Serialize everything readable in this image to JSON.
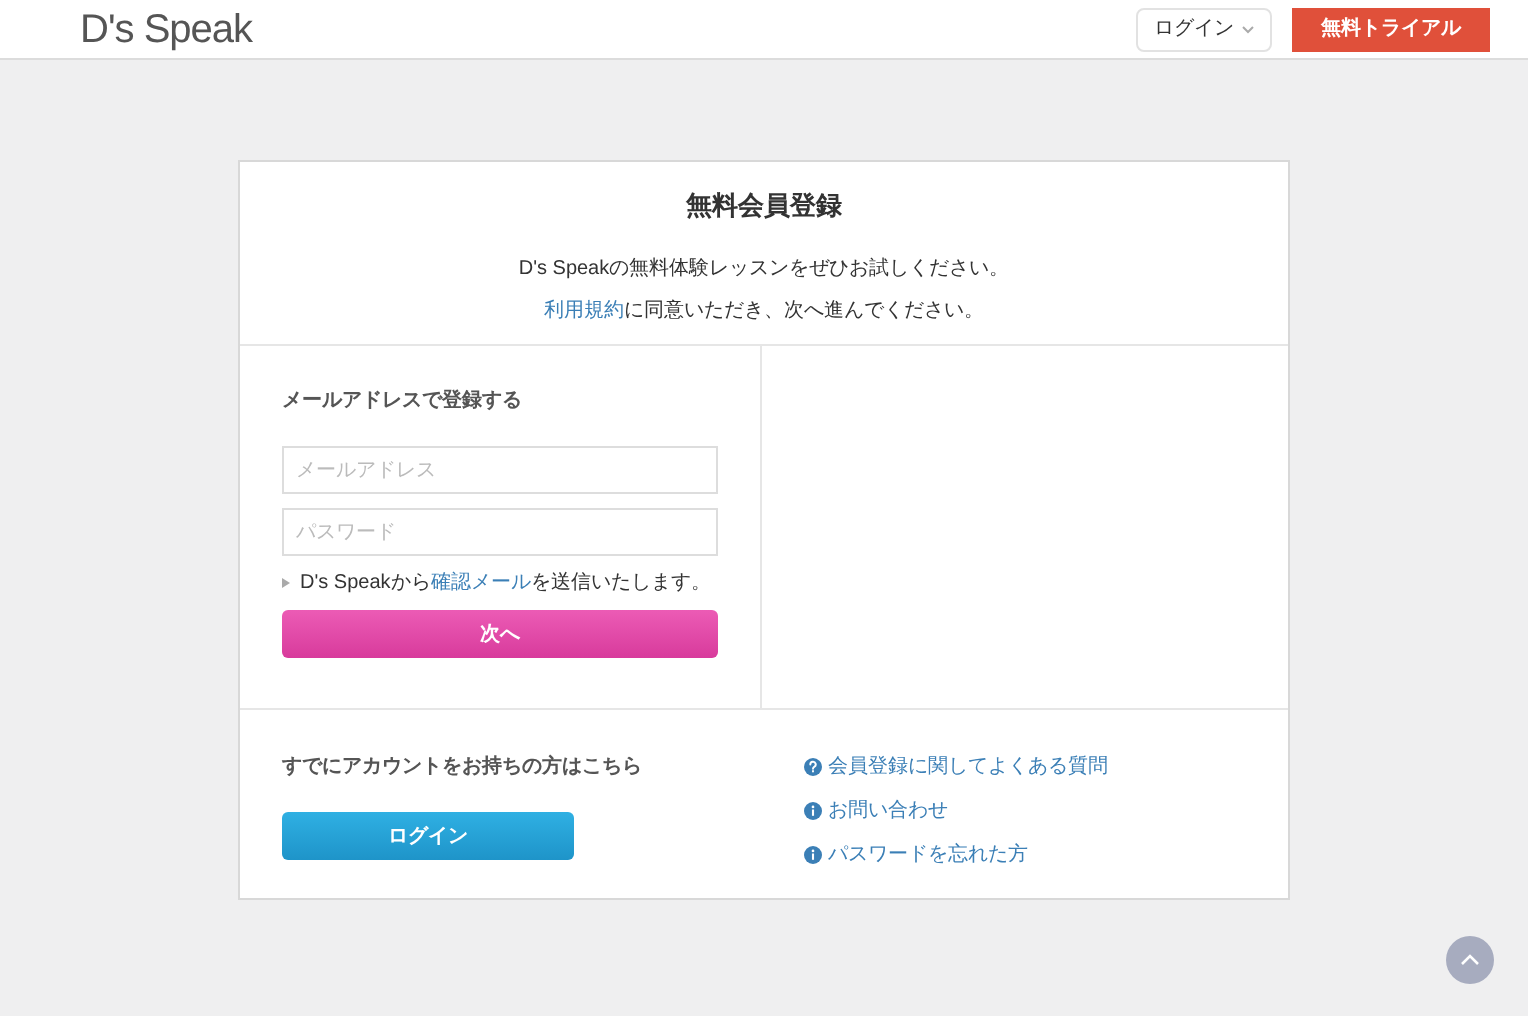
{
  "header": {
    "logo": "D's Speak",
    "login_menu": "ログイン",
    "trial_button": "無料トライアル"
  },
  "card": {
    "title": "無料会員登録",
    "intro": "D's Speakの無料体験レッスンをぜひお試しください。",
    "terms": {
      "link": "利用規約",
      "after": "に同意いただき、次へ進んでください。"
    },
    "email_section": {
      "heading": "メールアドレスで登録する",
      "email_placeholder": "メールアドレス",
      "password_placeholder": "パスワード",
      "notice": {
        "before": "D's Speakから",
        "link": "確認メール",
        "after": "を送信いたします。"
      },
      "next_button": "次へ"
    },
    "account": {
      "heading": "すでにアカウントをお持ちの方はこちら",
      "login_button": "ログイン"
    },
    "links": [
      {
        "kind": "question",
        "label": "会員登録に関してよくある質問"
      },
      {
        "kind": "info",
        "label": "お問い合わせ"
      },
      {
        "kind": "info",
        "label": "パスワードを忘れた方"
      }
    ]
  }
}
